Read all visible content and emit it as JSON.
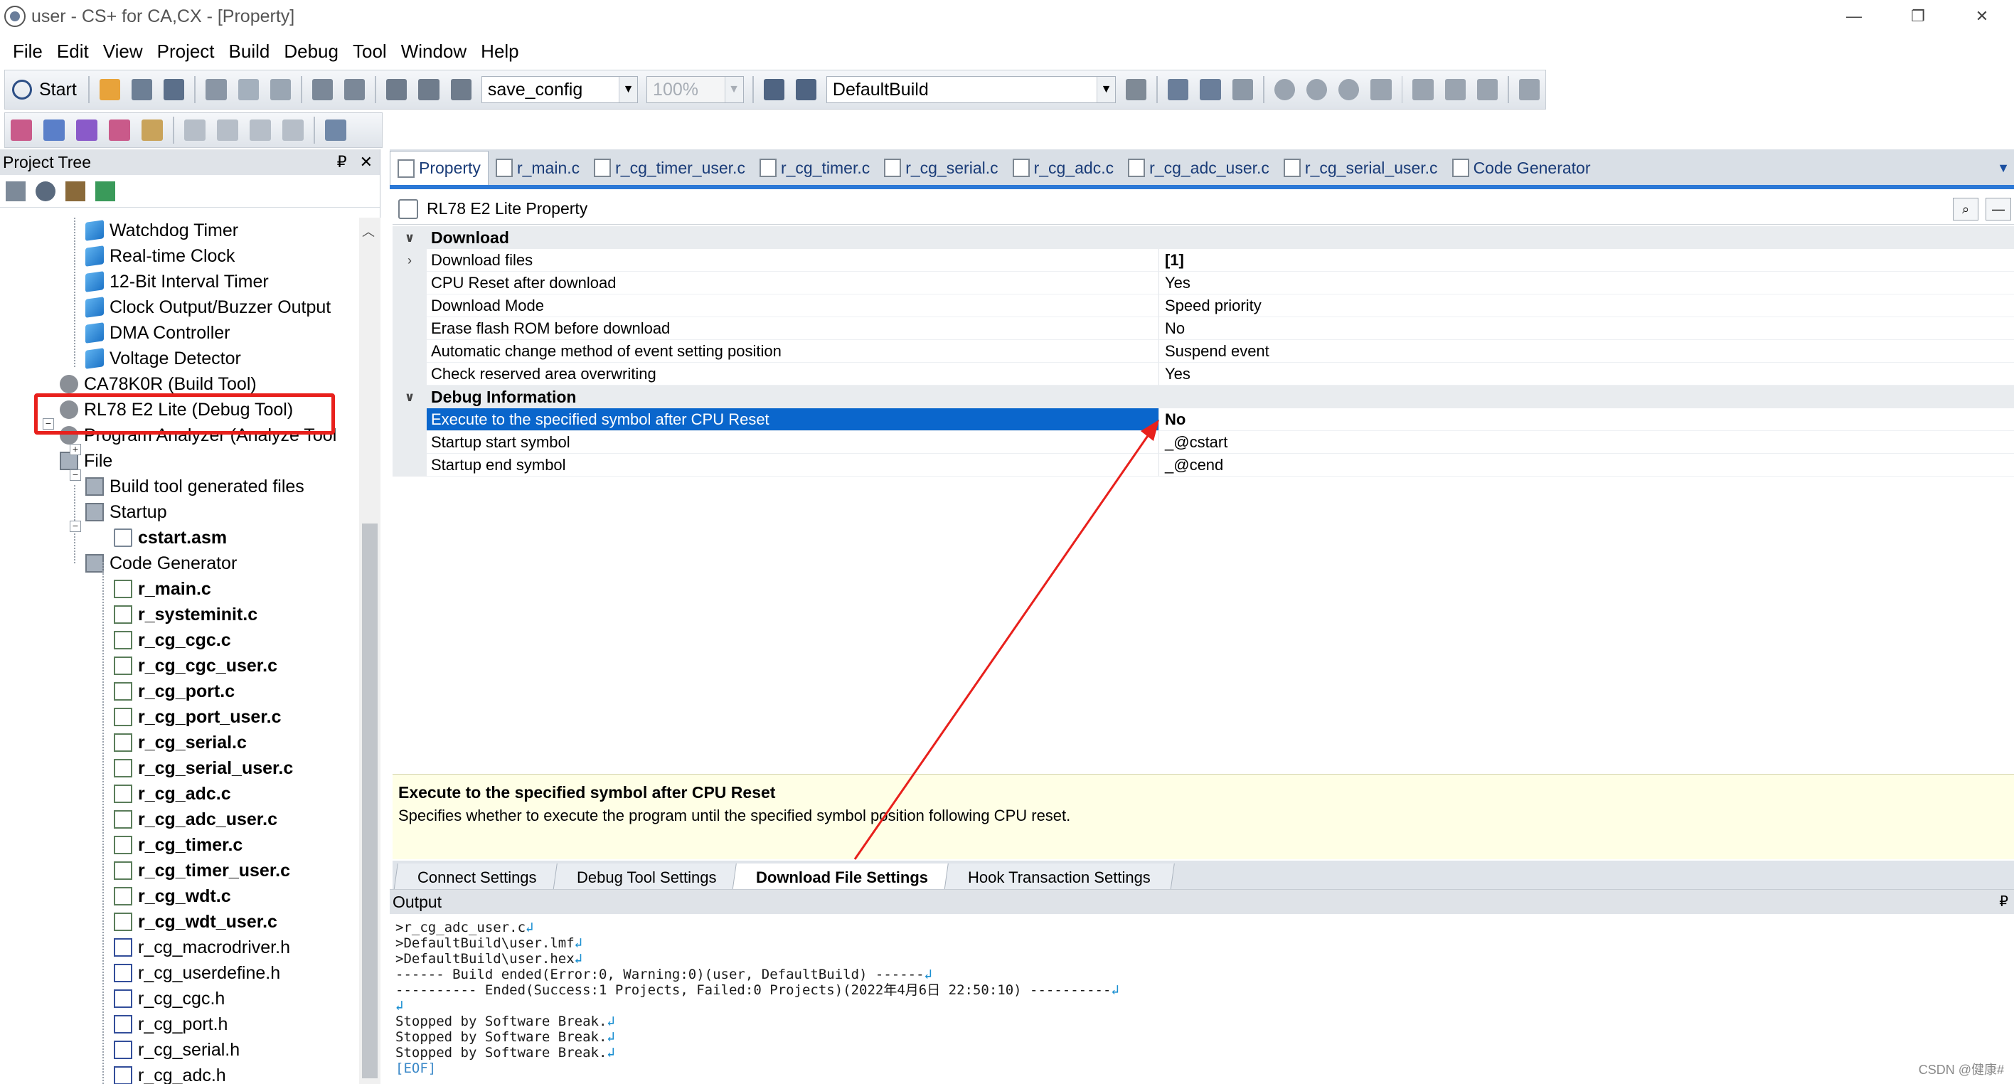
{
  "window": {
    "title": "user - CS+ for CA,CX - [Property]",
    "controls": [
      "—",
      "❐",
      "✕"
    ]
  },
  "menubar": [
    "File",
    "Edit",
    "View",
    "Project",
    "Build",
    "Debug",
    "Tool",
    "Window",
    "Help"
  ],
  "toolbar": {
    "start_label": "Start",
    "config_combo": "save_config",
    "zoom_combo": "100%",
    "build_combo": "DefaultBuild"
  },
  "project_tree": {
    "title": "Project Tree",
    "pin": "₽",
    "close": "✕",
    "nodes": [
      {
        "label": "Watchdog Timer",
        "icon": "cube-icon",
        "bold": false
      },
      {
        "label": "Real-time Clock",
        "icon": "cube-icon",
        "bold": false
      },
      {
        "label": "12-Bit Interval Timer",
        "icon": "cube-icon",
        "bold": false
      },
      {
        "label": "Clock Output/Buzzer Output",
        "icon": "cube-icon",
        "bold": false
      },
      {
        "label": "DMA Controller",
        "icon": "cube-icon",
        "bold": false
      },
      {
        "label": "Voltage Detector",
        "icon": "cube-icon",
        "bold": false
      },
      {
        "label": "CA78K0R (Build Tool)",
        "icon": "build-tool-icon",
        "bold": false
      },
      {
        "label": "RL78 E2 Lite (Debug Tool)",
        "icon": "debug-tool-icon",
        "bold": false
      },
      {
        "label": "Program Analyzer (Analyze Tool",
        "icon": "analyze-tool-icon",
        "bold": false
      },
      {
        "label": "File",
        "icon": "folder-icon",
        "bold": false
      },
      {
        "label": "Build tool generated files",
        "icon": "folder-icon",
        "bold": false
      },
      {
        "label": "Startup",
        "icon": "folder-icon",
        "bold": false
      },
      {
        "label": "cstart.asm",
        "icon": "asm-file-icon",
        "bold": true
      },
      {
        "label": "Code Generator",
        "icon": "folder-icon",
        "bold": false
      },
      {
        "label": "r_main.c",
        "icon": "c-file-icon",
        "bold": true
      },
      {
        "label": "r_systeminit.c",
        "icon": "c-file-icon",
        "bold": true
      },
      {
        "label": "r_cg_cgc.c",
        "icon": "c-file-icon",
        "bold": true
      },
      {
        "label": "r_cg_cgc_user.c",
        "icon": "c-file-icon",
        "bold": true
      },
      {
        "label": "r_cg_port.c",
        "icon": "c-file-icon",
        "bold": true
      },
      {
        "label": "r_cg_port_user.c",
        "icon": "c-file-icon",
        "bold": true
      },
      {
        "label": "r_cg_serial.c",
        "icon": "c-file-icon",
        "bold": true
      },
      {
        "label": "r_cg_serial_user.c",
        "icon": "c-file-icon",
        "bold": true
      },
      {
        "label": "r_cg_adc.c",
        "icon": "c-file-icon",
        "bold": true
      },
      {
        "label": "r_cg_adc_user.c",
        "icon": "c-file-icon",
        "bold": true
      },
      {
        "label": "r_cg_timer.c",
        "icon": "c-file-icon",
        "bold": true
      },
      {
        "label": "r_cg_timer_user.c",
        "icon": "c-file-icon",
        "bold": true
      },
      {
        "label": "r_cg_wdt.c",
        "icon": "c-file-icon",
        "bold": true
      },
      {
        "label": "r_cg_wdt_user.c",
        "icon": "c-file-icon",
        "bold": true
      },
      {
        "label": "r_cg_macrodriver.h",
        "icon": "h-file-icon",
        "bold": false
      },
      {
        "label": "r_cg_userdefine.h",
        "icon": "h-file-icon",
        "bold": false
      },
      {
        "label": "r_cg_cgc.h",
        "icon": "h-file-icon",
        "bold": false
      },
      {
        "label": "r_cg_port.h",
        "icon": "h-file-icon",
        "bold": false
      },
      {
        "label": "r_cg_serial.h",
        "icon": "h-file-icon",
        "bold": false
      },
      {
        "label": "r_cg_adc.h",
        "icon": "h-file-icon",
        "bold": false
      }
    ]
  },
  "editor_tabs": [
    {
      "label": "Property",
      "active": true
    },
    {
      "label": "r_main.c",
      "active": false
    },
    {
      "label": "r_cg_timer_user.c",
      "active": false
    },
    {
      "label": "r_cg_timer.c",
      "active": false
    },
    {
      "label": "r_cg_serial.c",
      "active": false
    },
    {
      "label": "r_cg_adc.c",
      "active": false
    },
    {
      "label": "r_cg_adc_user.c",
      "active": false
    },
    {
      "label": "r_cg_serial_user.c",
      "active": false
    },
    {
      "label": "Code Generator",
      "active": false
    }
  ],
  "property": {
    "title": "RL78 E2 Lite Property",
    "rows": [
      {
        "type": "category",
        "expander": "∨",
        "name": "Download",
        "value": ""
      },
      {
        "type": "row",
        "expander": "›",
        "name": "Download files",
        "value": "[1]",
        "bold_value": true
      },
      {
        "type": "row",
        "expander": "",
        "name": "CPU Reset after download",
        "value": "Yes"
      },
      {
        "type": "row",
        "expander": "",
        "name": "Download Mode",
        "value": "Speed priority"
      },
      {
        "type": "row",
        "expander": "",
        "name": "Erase flash ROM before download",
        "value": "No"
      },
      {
        "type": "row",
        "expander": "",
        "name": "Automatic change method of event setting position",
        "value": "Suspend event"
      },
      {
        "type": "row",
        "expander": "",
        "name": "Check reserved area overwriting",
        "value": "Yes"
      },
      {
        "type": "category",
        "expander": "∨",
        "name": "Debug Information",
        "value": ""
      },
      {
        "type": "selected",
        "expander": "",
        "name": "Execute to the specified symbol after CPU Reset",
        "value": "No"
      },
      {
        "type": "row",
        "expander": "",
        "name": "Startup start symbol",
        "value": "_@cstart"
      },
      {
        "type": "row",
        "expander": "",
        "name": "Startup end symbol",
        "value": "_@cend"
      }
    ],
    "description_title": "Execute to the specified symbol after CPU Reset",
    "description_text": "Specifies whether to execute the program until the specified symbol position following CPU reset."
  },
  "bottom_tabs": [
    {
      "label": "Connect Settings",
      "active": false
    },
    {
      "label": "Debug Tool Settings",
      "active": false
    },
    {
      "label": "Download File Settings",
      "active": true
    },
    {
      "label": "Hook Transaction Settings",
      "active": false
    }
  ],
  "output": {
    "title": "Output",
    "lines": [
      ">r_cg_adc_user.c",
      ">DefaultBuild\\user.lmf",
      ">DefaultBuild\\user.hex",
      "------ Build ended(Error:0, Warning:0)(user, DefaultBuild) ------",
      "---------- Ended(Success:1 Projects, Failed:0 Projects)(2022年4月6日 22:50:10) ----------",
      "",
      "Stopped by Software Break.",
      "Stopped by Software Break.",
      "Stopped by Software Break."
    ],
    "eof": "[EOF]"
  },
  "watermark": "CSDN @健康#",
  "colors": {
    "selection": "#0a66cc",
    "highlight_box": "#e8201c",
    "tab_accent": "#2b78d6",
    "description_bg": "#ffffe6"
  }
}
